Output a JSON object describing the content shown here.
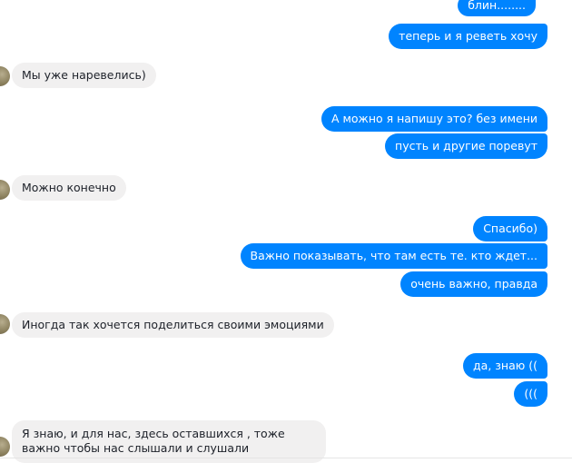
{
  "messages": [
    {
      "side": "out",
      "text": "блин........"
    },
    {
      "side": "out",
      "text": "теперь и я реветь хочу"
    },
    {
      "side": "in",
      "text": "Мы уже наревелись)"
    },
    {
      "side": "out",
      "text": "А можно я напишу это? без имени"
    },
    {
      "side": "out",
      "text": "пусть и другие поревут"
    },
    {
      "side": "in",
      "text": "Можно конечно"
    },
    {
      "side": "out",
      "text": "Спасибо)"
    },
    {
      "side": "out",
      "text": "Важно показывать, что там есть те. кто ждет..."
    },
    {
      "side": "out",
      "text": "очень важно, правда"
    },
    {
      "side": "in",
      "text": "Иногда так хочется поделиться своими эмоциями"
    },
    {
      "side": "out",
      "text": "да, знаю (("
    },
    {
      "side": "out",
      "text": "((("
    },
    {
      "side": "in",
      "text": "Я знаю, и для нас, здесь оставшихся , тоже важно чтобы нас слышали и слушали"
    }
  ],
  "colors": {
    "outgoing_bubble": "#0084ff",
    "incoming_bubble": "#f1f0f0"
  }
}
